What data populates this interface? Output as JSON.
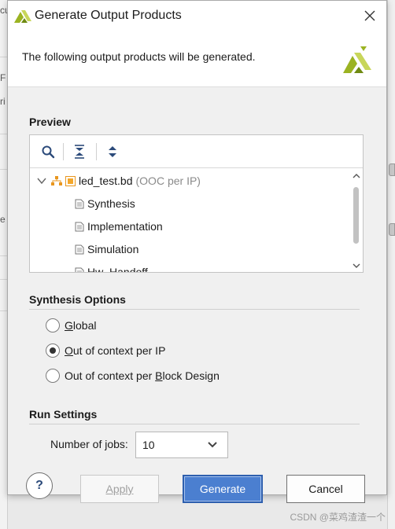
{
  "dialog": {
    "title": "Generate Output Products",
    "header_text": "The following output products will be generated."
  },
  "preview": {
    "title": "Preview",
    "toolbar": [
      "search-icon",
      "collapse-all-icon",
      "expand-all-icon"
    ],
    "tree": {
      "root": {
        "name": "led_test.bd",
        "suffix": "(OOC per IP)"
      },
      "children": [
        "Synthesis",
        "Implementation",
        "Simulation",
        "Hw_Handoff"
      ]
    }
  },
  "synthesis_options": {
    "title": "Synthesis Options",
    "options": [
      {
        "prefix": "",
        "mnemonic": "G",
        "rest": "lobal",
        "selected": false
      },
      {
        "prefix": "",
        "mnemonic": "O",
        "rest": "ut of context per IP",
        "selected": true
      },
      {
        "prefix": "Out of context per ",
        "mnemonic": "B",
        "rest": "lock Design",
        "selected": false
      }
    ]
  },
  "run_settings": {
    "title": "Run Settings",
    "jobs_label": "Number of jobs:",
    "jobs_value": "10"
  },
  "buttons": {
    "help": "?",
    "apply": "Apply",
    "generate": "Generate",
    "cancel": "Cancel"
  },
  "watermark": "CSDN @菜鸡渣渣一个",
  "colors": {
    "accent": "#4b7fd0",
    "logo_green": "#9bb322"
  }
}
